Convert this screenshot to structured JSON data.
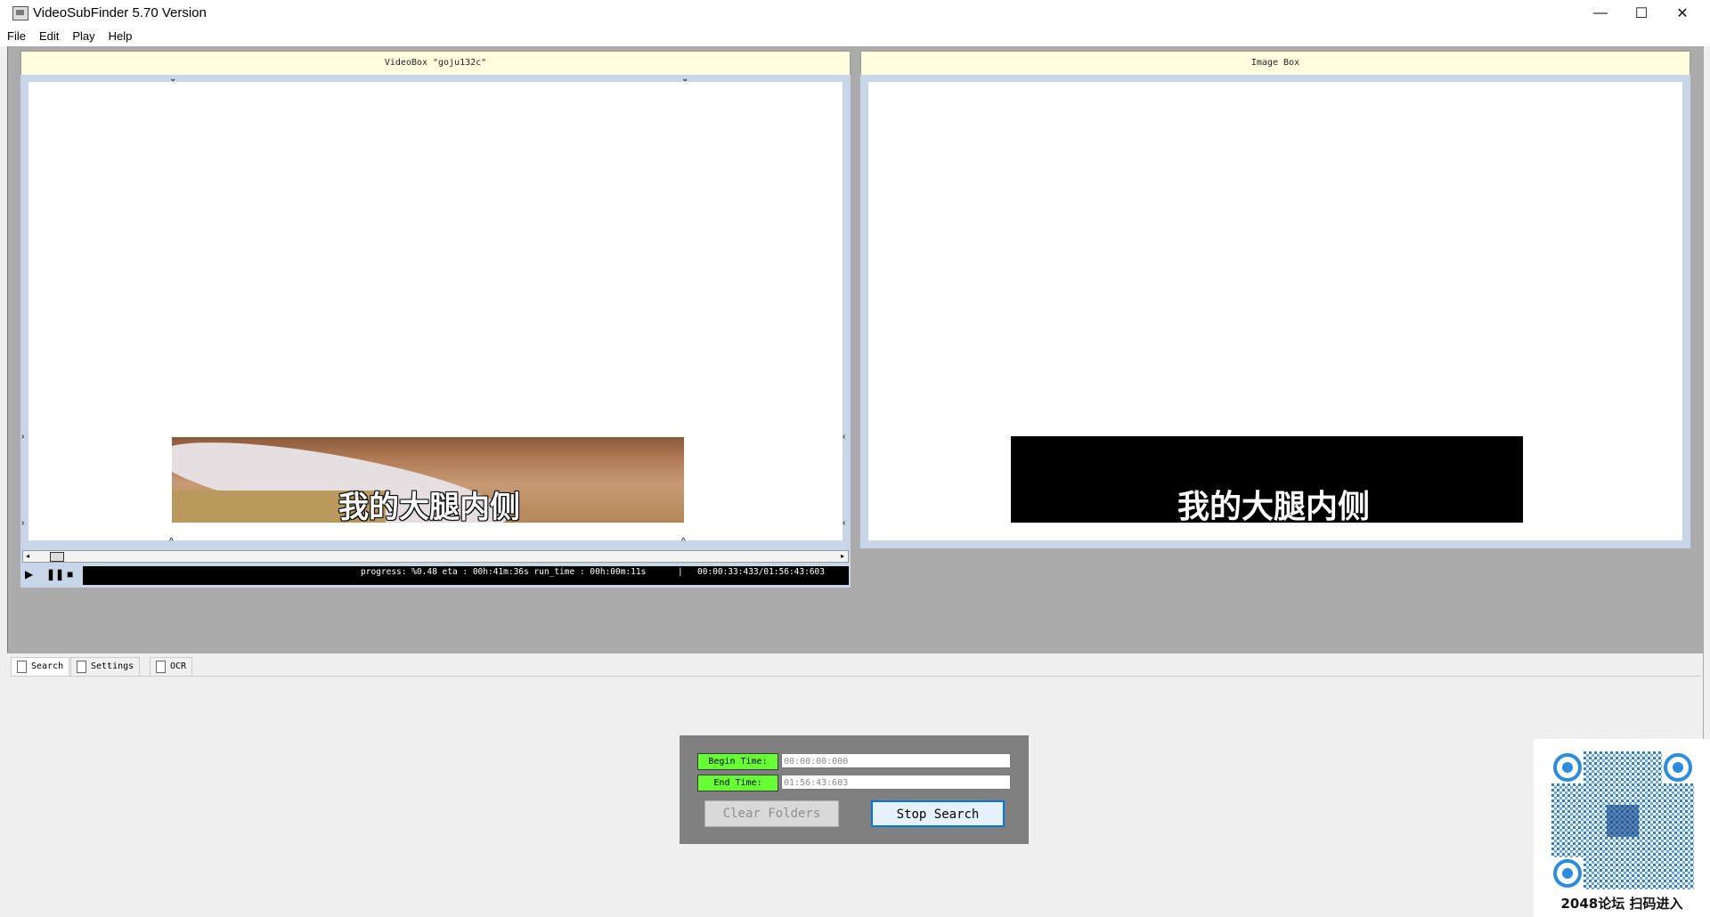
{
  "window": {
    "title": "VideoSubFinder 5.70 Version",
    "minimize_glyph": "—",
    "maximize_glyph": "☐",
    "close_glyph": "✕"
  },
  "menu": [
    "File",
    "Edit",
    "Play",
    "Help"
  ],
  "video_box": {
    "title": "VideoBox \"goju132c\"",
    "subtitle": "我的大腿内侧"
  },
  "image_box": {
    "title": "Image Box",
    "subtitle": "我的大腿内侧"
  },
  "player": {
    "status": "progress: %0.48 eta : 00h:41m:36s run_time : 00h:00m:11s",
    "time": "00:00:33:433/01:56:43:603",
    "separator": "|",
    "progress_fraction": 0.0048
  },
  "tabs": [
    "Search",
    "Settings",
    "OCR"
  ],
  "search": {
    "begin_label": "Begin Time:",
    "begin_value": "00:00:00:000",
    "end_label": "End Time:",
    "end_value": "01:56:43:603",
    "clear_button": "Clear Folders",
    "stop_button": "Stop Search"
  },
  "qr": {
    "caption": "2048论坛 扫码进入"
  },
  "colors": {
    "header_bg": "#ffffe0",
    "frame_bg": "#c8d6ea",
    "time_label_bg": "#66ff33",
    "workspace_bg": "#ababab"
  }
}
